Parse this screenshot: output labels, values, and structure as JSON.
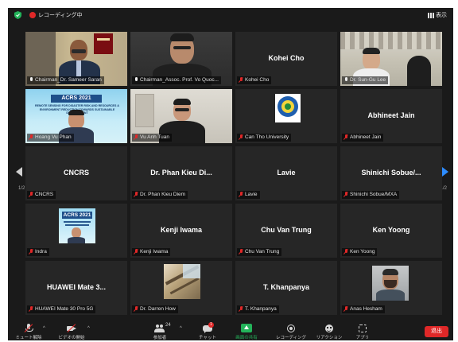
{
  "topbar": {
    "recording_label": "レコーディング中",
    "view_label": "表示"
  },
  "grid": {
    "page_left": "1/2",
    "page_right": "1/2",
    "tiles": [
      {
        "name": "Chairman_Dr. Sameer Saran",
        "muted": false,
        "video": true
      },
      {
        "name": "Chairman_Assoc. Prof. Vo Quoc...",
        "muted": false,
        "video": true
      },
      {
        "name": "Kohei Cho",
        "display": "Kohei Cho",
        "muted": true,
        "video": false
      },
      {
        "name": "Dr. Sun-Gu Lee",
        "muted": false,
        "video": true
      },
      {
        "name": "Hoang Vu Phan",
        "muted": true,
        "video": true,
        "banner_line1": "ACRS 2021",
        "banner_line2": "REMOTE SENSING FOR DISASTER RISK AND RESOURCES & ENVIRONMENT REDUCTION TOWARDS SUSTAINABLE DEVELOPMENT"
      },
      {
        "name": "Vu Anh Tuan",
        "muted": true,
        "video": true
      },
      {
        "name": "Can Tho University",
        "muted": true,
        "video": true
      },
      {
        "name": "Abhineet Jain",
        "display": "Abhineet Jain",
        "muted": true,
        "video": false
      },
      {
        "name": "CNCRS",
        "display": "CNCRS",
        "muted": true,
        "video": false
      },
      {
        "name": "Dr. Phan Kieu Diem",
        "display": "Dr. Phan Kieu Di...",
        "muted": true,
        "video": false
      },
      {
        "name": "Lavie",
        "display": "Lavie",
        "muted": true,
        "video": false
      },
      {
        "name": "Shinichi Sobue/MXA",
        "display": "Shinichi Sobue/...",
        "muted": true,
        "video": false
      },
      {
        "name": "Indra",
        "muted": true,
        "video": true,
        "banner_line1": "ACRS 2021"
      },
      {
        "name": "Kenji Iwama",
        "display": "Kenji Iwama",
        "muted": true,
        "video": false
      },
      {
        "name": "Chu Van Trung",
        "display": "Chu Van Trung",
        "muted": true,
        "video": false
      },
      {
        "name": "Ken Yoong",
        "display": "Ken Yoong",
        "muted": true,
        "video": false
      },
      {
        "name": "HUAWEI Mate 30 Pro 5G",
        "display": "HUAWEI Mate 3...",
        "muted": true,
        "video": false
      },
      {
        "name": "Dr. Darren How",
        "muted": true,
        "video": true
      },
      {
        "name": "T. Khanpanya",
        "display": "T. Khanpanya",
        "muted": true,
        "video": false
      },
      {
        "name": "Anas Hesham",
        "muted": true,
        "video": true
      }
    ]
  },
  "toolbar": {
    "mute_label": "ミュート解除",
    "video_label": "ビデオの開始",
    "participants_label": "参加者",
    "participants_count": "24",
    "chat_label": "チャット",
    "chat_badge": "1",
    "share_label": "画面の共有",
    "record_label": "レコーディング",
    "reactions_label": "リアクション",
    "apps_label": "アプリ",
    "end_label": "退出"
  },
  "colors": {
    "background": "#1a1a1a",
    "tile": "#262626",
    "active_speaker": "#b5d12e",
    "muted_red": "#e02828",
    "share_green": "#23b35a",
    "nav_blue": "#2d8cff"
  }
}
